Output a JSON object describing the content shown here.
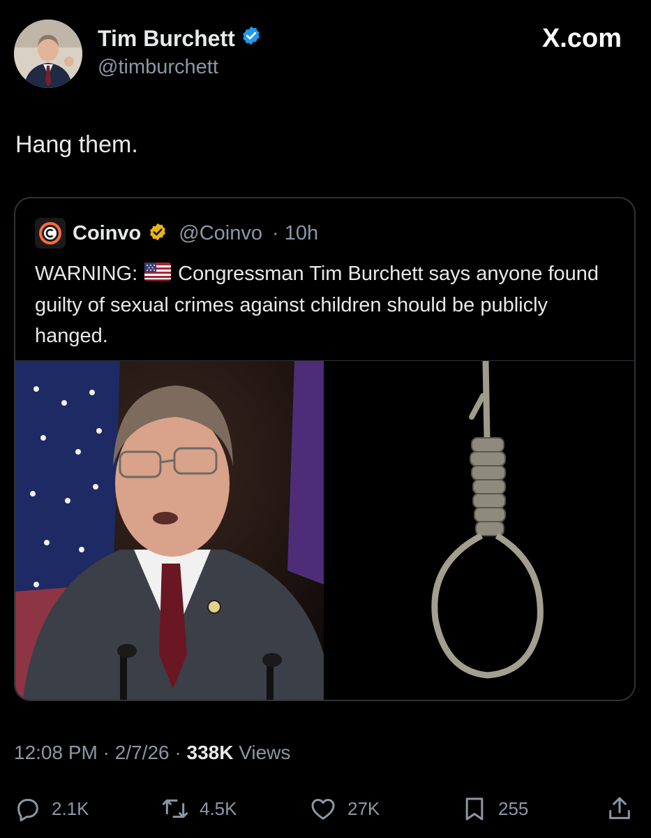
{
  "author": {
    "name": "Tim Burchett",
    "handle": "@timburchett",
    "verified": true,
    "verified_color": "#1d9bf0"
  },
  "brand": "X.com",
  "tweet": {
    "text": "Hang them."
  },
  "quoted": {
    "name": "Coinvo",
    "handle": "@Coinvo",
    "time": "· 10h",
    "verified_color": "#e8b410",
    "text_before_flag": "WARNING:",
    "flag_icon": "us-flag-icon",
    "text_after_flag": "Congressman Tim Burchett says anyone found guilty of sexual crimes against children should be publicly hanged."
  },
  "meta": {
    "time": "12:08 PM",
    "date": "2/7/26",
    "views_count": "338K",
    "views_label": "Views"
  },
  "actions": {
    "replies": "2.1K",
    "reposts": "4.5K",
    "likes": "27K",
    "bookmarks": "255"
  },
  "colors": {
    "background": "#000000",
    "text": "#e7e9ea",
    "secondary": "#8b98a5",
    "border": "#2f3336"
  }
}
